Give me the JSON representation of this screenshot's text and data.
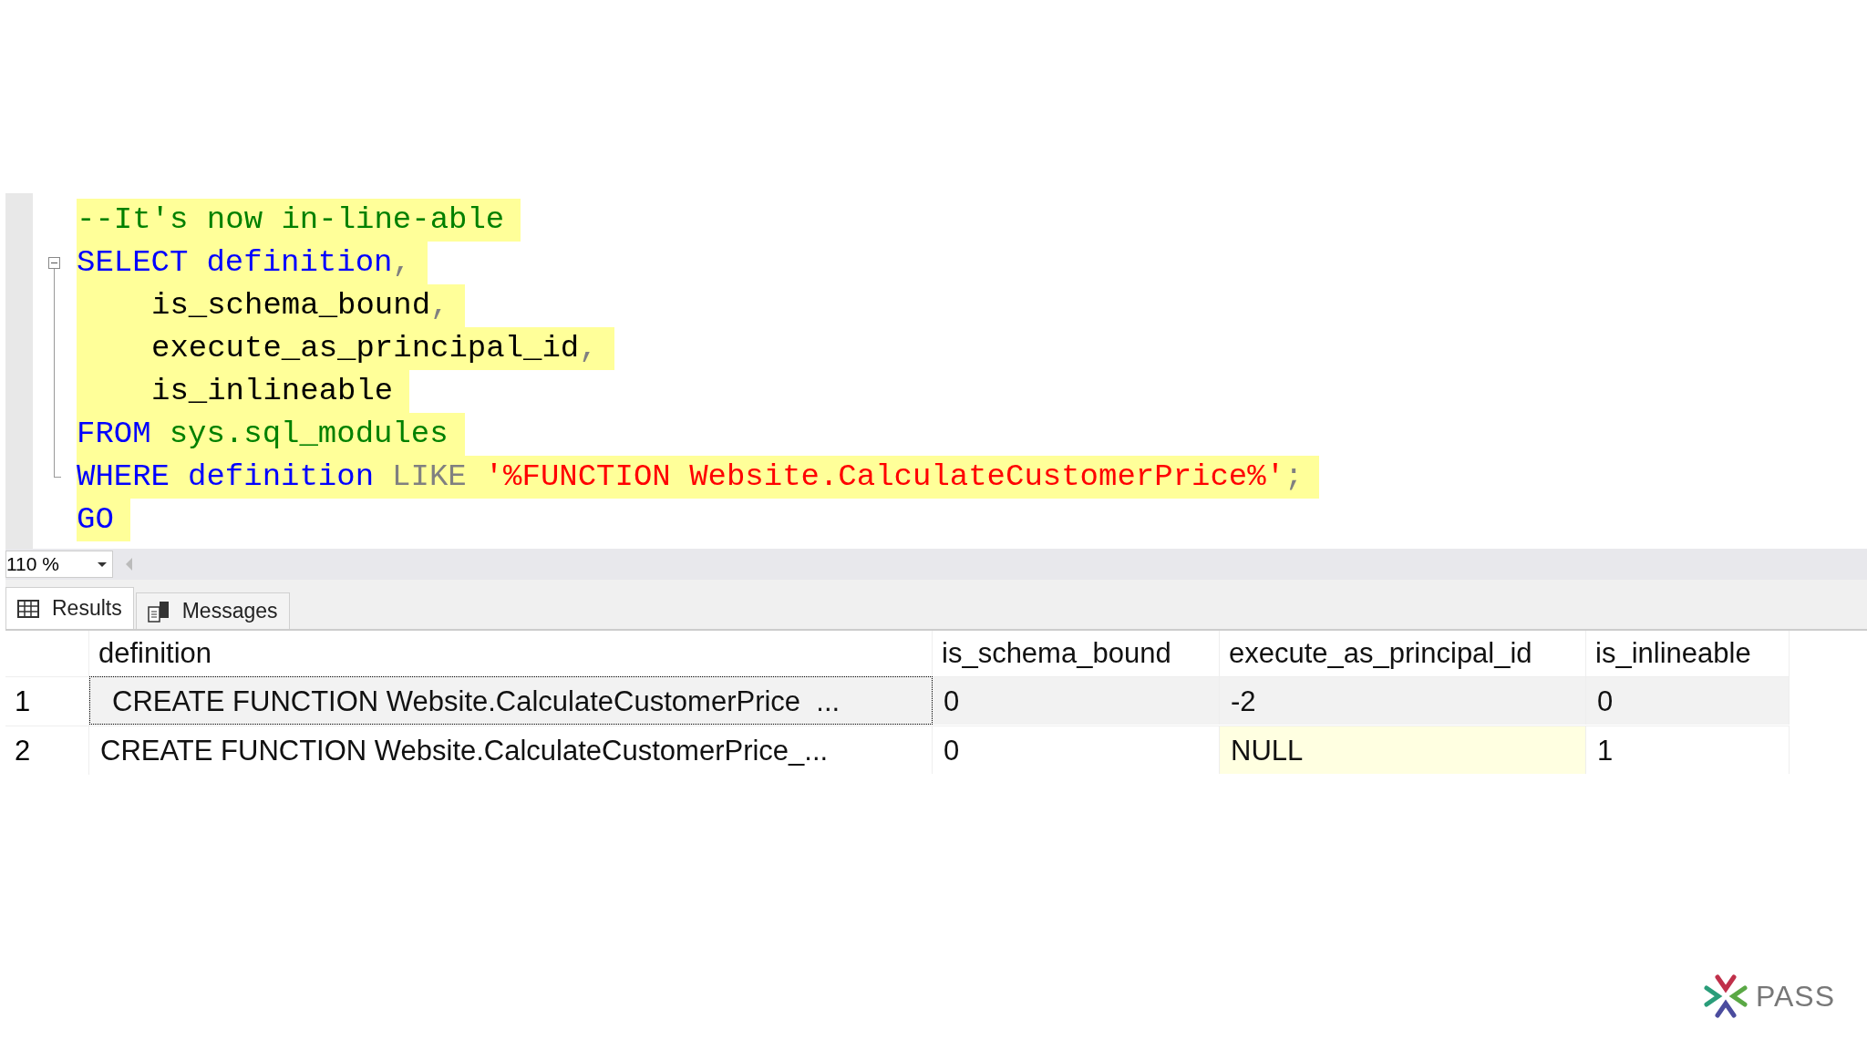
{
  "editor": {
    "lines": [
      {
        "collapsible": false,
        "in_block": false,
        "tokens": [
          {
            "kind": "comment",
            "text": "--It's now in-line-able"
          }
        ]
      },
      {
        "collapsible": true,
        "in_block": true,
        "tokens": [
          {
            "kind": "keyword",
            "text": "SELECT"
          },
          {
            "kind": "keyword",
            "text": "definition"
          },
          {
            "kind": "punct",
            "text": ","
          }
        ]
      },
      {
        "collapsible": false,
        "in_block": true,
        "indented": true,
        "tokens": [
          {
            "kind": "plain",
            "text": "is_schema_bound"
          },
          {
            "kind": "punct",
            "text": ","
          }
        ]
      },
      {
        "collapsible": false,
        "in_block": true,
        "indented": true,
        "tokens": [
          {
            "kind": "plain",
            "text": "execute_as_principal_id"
          },
          {
            "kind": "punct",
            "text": ","
          }
        ]
      },
      {
        "collapsible": false,
        "in_block": true,
        "indented": true,
        "tokens": [
          {
            "kind": "plain",
            "text": "is_inlineable"
          }
        ]
      },
      {
        "collapsible": false,
        "in_block": true,
        "tokens": [
          {
            "kind": "keyword",
            "text": "FROM"
          },
          {
            "kind": "system",
            "text": "sys.sql_modules"
          }
        ]
      },
      {
        "collapsible": false,
        "in_block": true,
        "tokens": [
          {
            "kind": "keyword",
            "text": "WHERE"
          },
          {
            "kind": "keyword",
            "text": "definition"
          },
          {
            "kind": "operator",
            "text": "LIKE"
          },
          {
            "kind": "string",
            "text": "'%FUNCTION Website.CalculateCustomerPrice%'"
          },
          {
            "kind": "punct",
            "text": ";"
          }
        ]
      },
      {
        "collapsible": false,
        "in_block": false,
        "tokens": [
          {
            "kind": "keyword",
            "text": "GO"
          }
        ]
      }
    ]
  },
  "zoom": {
    "value": "110 %"
  },
  "tabs": [
    {
      "label": "Results",
      "selected": true,
      "kind": "grid"
    },
    {
      "label": "Messages",
      "selected": false,
      "kind": "messages"
    }
  ],
  "results": {
    "columns": [
      "definition",
      "is_schema_bound",
      "execute_as_principal_id",
      "is_inlineable"
    ],
    "rows": [
      {
        "number": "1",
        "selected": true,
        "cells": [
          {
            "text": "CREATE FUNCTION Website.CalculateCustomerPrice  ...",
            "kind": "value"
          },
          {
            "text": "0",
            "kind": "value"
          },
          {
            "text": "-2",
            "kind": "value"
          },
          {
            "text": "0",
            "kind": "value"
          }
        ]
      },
      {
        "number": "2",
        "selected": false,
        "cells": [
          {
            "text": "CREATE FUNCTION Website.CalculateCustomerPrice_...",
            "kind": "value"
          },
          {
            "text": "0",
            "kind": "value"
          },
          {
            "text": "NULL",
            "kind": "null"
          },
          {
            "text": "1",
            "kind": "value"
          }
        ]
      }
    ]
  },
  "logo": {
    "text": "PASS"
  }
}
